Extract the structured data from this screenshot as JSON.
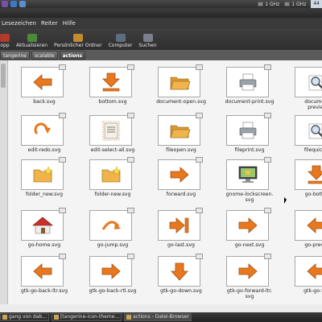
{
  "topbar": {
    "cpu1": "1 GHz",
    "cpu2": "1 GHz",
    "time": "44"
  },
  "menubar": {
    "items": [
      "Lesezeichen",
      "Reiter",
      "Hilfe"
    ]
  },
  "toolbar": {
    "tools": [
      {
        "label": "opp",
        "icon": "stop-icon"
      },
      {
        "label": "Aktualisieren",
        "icon": "reload-icon"
      },
      {
        "label": "Persönlicher Ordner",
        "icon": "home-folder-icon"
      },
      {
        "label": "Computer",
        "icon": "computer-icon"
      },
      {
        "label": "Suchen",
        "icon": "search-icon"
      }
    ]
  },
  "pathbar": {
    "crumbs": [
      "tangerine",
      "scalable",
      "actions"
    ]
  },
  "files": [
    {
      "name": "back.svg",
      "icon": "arrow-left"
    },
    {
      "name": "bottom.svg",
      "icon": "arrow-bottom"
    },
    {
      "name": "document-open.svg",
      "icon": "folder-open"
    },
    {
      "name": "document-print.svg",
      "icon": "printer"
    },
    {
      "name": "document-\npreview.",
      "icon": "magnifier-doc"
    },
    {
      "name": "edit-redo.svg",
      "icon": "redo"
    },
    {
      "name": "edit-select-all.svg",
      "icon": "select-all"
    },
    {
      "name": "fileopen.svg",
      "icon": "folder-open"
    },
    {
      "name": "fileprint.svg",
      "icon": "printer"
    },
    {
      "name": "filequickpri",
      "icon": "magnifier-doc"
    },
    {
      "name": "folder_new.svg",
      "icon": "folder-new"
    },
    {
      "name": "folder-new.svg",
      "icon": "folder-new"
    },
    {
      "name": "forward.svg",
      "icon": "arrow-right"
    },
    {
      "name": "gnome-lockscreen.\nsvg",
      "icon": "lockscreen"
    },
    {
      "name": "go-bottom",
      "icon": "arrow-bottom"
    },
    {
      "name": "go-home.svg",
      "icon": "home"
    },
    {
      "name": "go-jump.svg",
      "icon": "jump"
    },
    {
      "name": "go-last.svg",
      "icon": "arrow-last"
    },
    {
      "name": "go-next.svg",
      "icon": "arrow-right"
    },
    {
      "name": "go-previou",
      "icon": "arrow-left"
    },
    {
      "name": "gtk-go-back-ltr.svg",
      "icon": "arrow-left"
    },
    {
      "name": "gtk-go-back-rtl.svg",
      "icon": "arrow-right"
    },
    {
      "name": "gtk-go-down.svg",
      "icon": "arrow-down"
    },
    {
      "name": "gtk-go-forward-ltr.\nsvg",
      "icon": "arrow-right"
    },
    {
      "name": "gtk-go-forw",
      "icon": "arrow-left"
    }
  ],
  "taskbar": {
    "items": [
      {
        "label": "gang von dab...",
        "active": false
      },
      {
        "label": "[tangerine-icon-theme...",
        "active": false
      },
      {
        "label": "actions - Datei-Browser",
        "active": true
      }
    ]
  },
  "colors": {
    "accent": "#e8781e",
    "folder": "#f0b44a"
  }
}
